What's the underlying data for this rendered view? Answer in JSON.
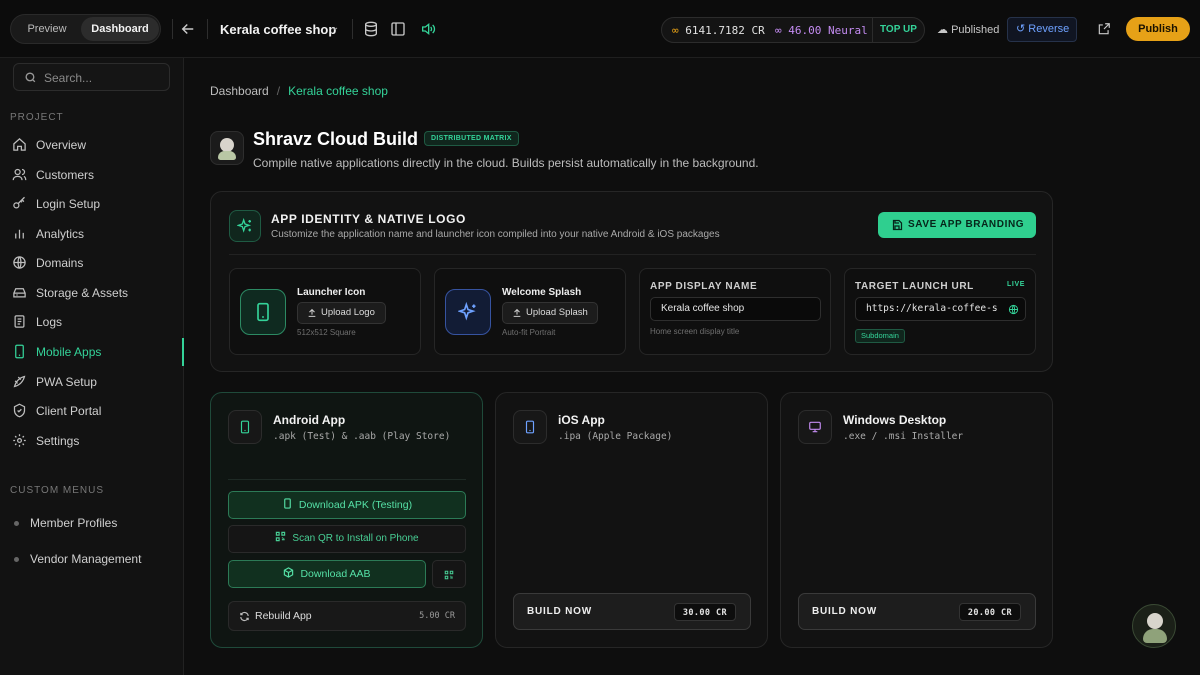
{
  "topbar": {
    "mode_options": [
      "Preview",
      "Dashboard"
    ],
    "active_mode": "Dashboard",
    "project_name": "Kerala coffee shop",
    "cr_balance": "6141.7182 CR",
    "neural_balance": "46.00 Neural",
    "top_up_label": "TOP UP",
    "status_label": "Published",
    "reverse_label": "Reverse",
    "publish_label": "Publish"
  },
  "sidebar": {
    "search_placeholder": "Search...",
    "project_heading": "PROJECT",
    "items": [
      {
        "label": "Overview",
        "icon": "home-icon"
      },
      {
        "label": "Customers",
        "icon": "users-icon"
      },
      {
        "label": "Login Setup",
        "icon": "key-icon"
      },
      {
        "label": "Analytics",
        "icon": "bar-chart-icon"
      },
      {
        "label": "Domains",
        "icon": "globe-icon"
      },
      {
        "label": "Storage & Assets",
        "icon": "storage-icon"
      },
      {
        "label": "Logs",
        "icon": "logs-icon"
      },
      {
        "label": "Mobile Apps",
        "icon": "smartphone-icon",
        "active": true
      },
      {
        "label": "PWA Setup",
        "icon": "pwa-icon"
      },
      {
        "label": "Client Portal",
        "icon": "shield-icon"
      },
      {
        "label": "Settings",
        "icon": "gear-icon"
      }
    ],
    "custom_heading": "CUSTOM MENUS",
    "custom_items": [
      "Member Profiles",
      "Vendor Management"
    ]
  },
  "breadcrumb": {
    "root": "Dashboard",
    "current": "Kerala coffee shop"
  },
  "header": {
    "title": "Shravz Cloud Build",
    "badge": "DISTRIBUTED MATRIX",
    "subtitle": "Compile native applications directly in the cloud. Builds persist automatically in the background."
  },
  "identity": {
    "title": "APP IDENTITY & NATIVE LOGO",
    "description": "Customize the application name and launcher icon compiled into your native Android & iOS packages",
    "save_label": "SAVE APP BRANDING",
    "launcher": {
      "title": "Launcher Icon",
      "button": "Upload Logo",
      "hint": "512x512 Square"
    },
    "splash": {
      "title": "Welcome Splash",
      "button": "Upload Splash",
      "hint": "Auto-fit Portrait"
    },
    "display_name": {
      "label": "APP DISPLAY NAME",
      "value": "Kerala coffee shop",
      "hint": "Home screen display title"
    },
    "launch_url": {
      "label": "TARGET LAUNCH URL",
      "live": "LIVE",
      "value": "https://kerala-coffee-s",
      "tag": "Subdomain"
    }
  },
  "platforms": {
    "android": {
      "title": "Android App",
      "desc": ".apk (Test) & .aab (Play Store)",
      "download_apk": "Download APK (Testing)",
      "scan_qr": "Scan QR to Install on Phone",
      "download_aab": "Download AAB",
      "rebuild": "Rebuild App",
      "rebuild_cost": "5.00 CR"
    },
    "ios": {
      "title": "iOS App",
      "desc": ".ipa (Apple Package)",
      "build_label": "BUILD NOW",
      "build_cost": "30.00 CR"
    },
    "windows": {
      "title": "Windows Desktop",
      "desc": ".exe / .msi Installer",
      "build_label": "BUILD NOW",
      "build_cost": "20.00 CR"
    }
  },
  "colors": {
    "accent_green": "#34d399",
    "publish_orange": "#e6a117",
    "reverse_blue": "#6ea1ff",
    "neural_purple": "#c48cf2"
  }
}
